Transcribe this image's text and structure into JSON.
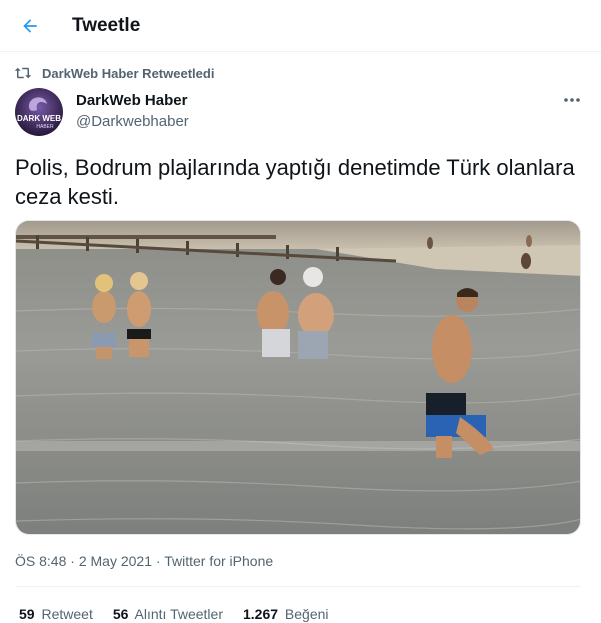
{
  "header": {
    "title": "Tweetle"
  },
  "retweet": {
    "label": "DarkWeb Haber Retweetledi"
  },
  "author": {
    "name": "DarkWeb Haber",
    "handle": "@Darkwebhaber",
    "avatar_text_1": "DARK WEB",
    "avatar_text_2": "HABER"
  },
  "tweet": {
    "text": "Polis, Bodrum plajlarında yaptığı denetimde Türk olanlara ceza kesti."
  },
  "meta": {
    "time": "ÖS 8:48",
    "sep1": "·",
    "date": "2 May 2021",
    "sep2": "·",
    "source": "Twitter for iPhone"
  },
  "stats": {
    "retweets_count": "59",
    "retweets_label": "Retweet",
    "quotes_count": "56",
    "quotes_label": "Alıntı Tweetler",
    "likes_count": "1.267",
    "likes_label": "Beğeni"
  },
  "colors": {
    "accent": "#1d9bf0",
    "muted": "#536471",
    "text": "#0f1419"
  },
  "icons": {
    "back": "arrow-left-icon",
    "retweet": "retweet-icon",
    "more": "more-horizontal-icon"
  }
}
